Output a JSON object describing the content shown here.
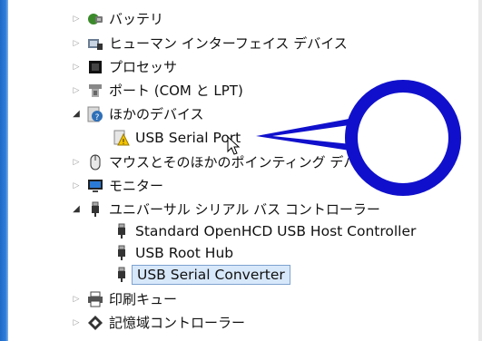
{
  "tree": {
    "items": [
      {
        "label": "バッテリ",
        "icon": "battery-icon",
        "state": "collapsed"
      },
      {
        "label": "ヒューマン インターフェイス デバイス",
        "icon": "hid-icon",
        "state": "collapsed"
      },
      {
        "label": "プロセッサ",
        "icon": "processor-icon",
        "state": "collapsed"
      },
      {
        "label": "ポート (COM と LPT)",
        "icon": "port-icon",
        "state": "collapsed"
      },
      {
        "label": "ほかのデバイス",
        "icon": "unknown-device-icon",
        "state": "expanded"
      },
      {
        "label": "USB Serial Port",
        "icon": "warning-device-icon",
        "state": "child"
      },
      {
        "label": "マウスとそのほかのポインティング デバイス",
        "icon": "mouse-icon",
        "state": "collapsed"
      },
      {
        "label": "モニター",
        "icon": "monitor-icon",
        "state": "collapsed"
      },
      {
        "label": "ユニバーサル シリアル バス コントローラー",
        "icon": "usb-icon",
        "state": "expanded"
      },
      {
        "label": "Standard OpenHCD USB Host Controller",
        "icon": "usb-plug-icon",
        "state": "child"
      },
      {
        "label": "USB Root Hub",
        "icon": "usb-plug-icon",
        "state": "child"
      },
      {
        "label": "USB Serial Converter",
        "icon": "usb-plug-icon",
        "state": "child-selected"
      },
      {
        "label": "印刷キュー",
        "icon": "printer-icon",
        "state": "collapsed"
      },
      {
        "label": "記憶域コントローラー",
        "icon": "storage-icon",
        "state": "collapsed"
      }
    ]
  },
  "annotation": {
    "shape": "speech-bubble-circle",
    "color": "#1010cc",
    "points_to": "USB Serial Port"
  }
}
